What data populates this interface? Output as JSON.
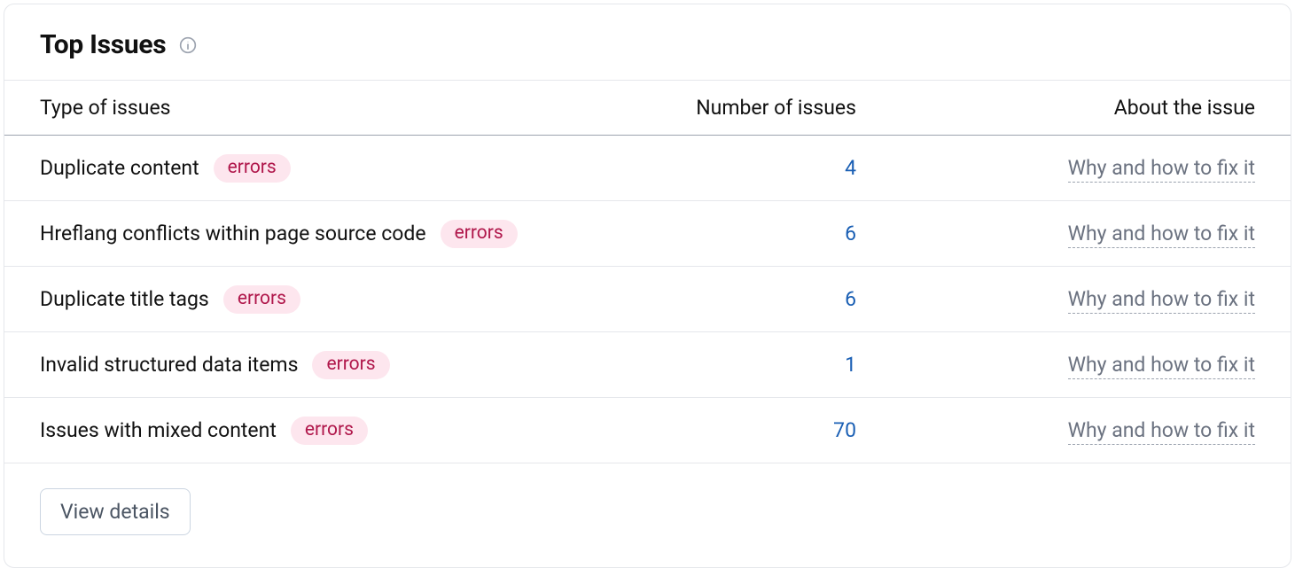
{
  "card": {
    "title": "Top Issues",
    "info_icon": "info-icon"
  },
  "columns": {
    "type": "Type of issues",
    "count": "Number of issues",
    "about": "About the issue"
  },
  "badge_label": "errors",
  "about_link_label": "Why and how to fix it",
  "rows": [
    {
      "name": "Duplicate content",
      "count": "4"
    },
    {
      "name": "Hreflang conflicts within page source code",
      "count": "6"
    },
    {
      "name": "Duplicate title tags",
      "count": "6"
    },
    {
      "name": "Invalid structured data items",
      "count": "1"
    },
    {
      "name": "Issues with mixed content",
      "count": "70"
    }
  ],
  "footer": {
    "view_details": "View details"
  }
}
